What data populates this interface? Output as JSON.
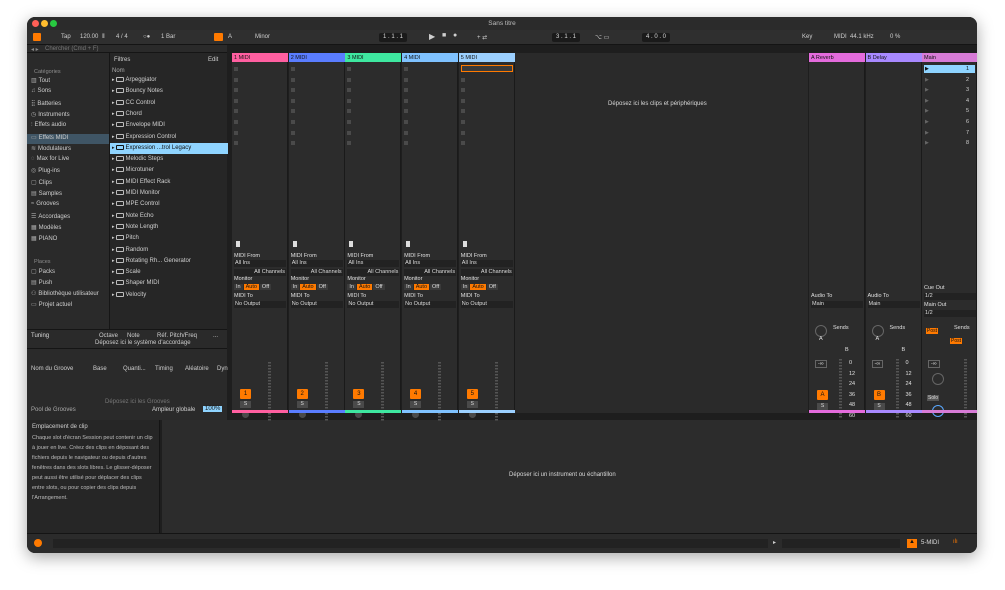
{
  "window": {
    "title": "Sans titre"
  },
  "toolbar": {
    "tap": "Tap",
    "tempo": "120.00",
    "signature": "4 / 4",
    "quantize": "1 Bar",
    "key_root": "A",
    "scale": "Minor",
    "position": "1 .  1 .  1",
    "loop_start": "3 .  1 .  1",
    "loop_length": "4 .  0 .  0",
    "key": "Key",
    "midi": "MIDI",
    "sample_rate": "44.1 kHz",
    "cpu": "0 %"
  },
  "browser": {
    "search_placeholder": "Chercher (Cmd + F)",
    "categories_label": "Catégories",
    "categories": [
      "Tout",
      "Sons",
      "Batteries",
      "Instruments",
      "Effets audio",
      "Effets MIDI",
      "Modulateurs",
      "Max for Live",
      "Plug-ins",
      "Clips",
      "Samples",
      "Grooves",
      "Accordages",
      "Modèles",
      "PIANO"
    ],
    "places_label": "Places",
    "places": [
      "Packs",
      "Push",
      "Bibliothèque utilisateur",
      "Projet actuel"
    ],
    "filters": "Filtres",
    "edit": "Edit",
    "name_col": "Nom",
    "items": [
      "Arpeggiator",
      "Bouncy Notes",
      "CC Control",
      "Chord",
      "Envelope MIDI",
      "Expression Control",
      "Expression ...trol Legacy",
      "Melodic Steps",
      "Microtuner",
      "MIDI Effect Rack",
      "MIDI Monitor",
      "MPE Control",
      "Note Echo",
      "Note Length",
      "Pitch",
      "Random",
      "Rotating Rh... Generator",
      "Scale",
      "Shaper MIDI",
      "Velocity"
    ]
  },
  "tuning": {
    "title": "Tuning",
    "cols": [
      "Octave",
      "Note",
      "Réf. Pitch/Freq",
      "..."
    ],
    "drop": "Déposez ici le système d'accordage"
  },
  "groove": {
    "cols": [
      "Nom du Groove",
      "Base",
      "Quanti...",
      "Timing",
      "Aléatoire",
      "Dyn"
    ],
    "drop": "Déposez ici les Grooves",
    "pool": "Pool de Grooves",
    "amount_label": "Ampleur globale",
    "amount": "100%"
  },
  "info": {
    "title": "Emplacement de clip",
    "text": "Chaque slot d'écran Session peut contenir un clip à jouer en live. Créez des clips en déposant des fichiers depuis le navigateur ou depuis d'autres fenêtres dans des slots libres. Le glisser-déposer peut aussi être utilisé pour déplacer des clips entre slots, ou pour copier des clips depuis l'Arrangement."
  },
  "session_drop": "Déposez ici les clips et périphériques",
  "detail_drop": "Déposer ici un instrument ou échantillon",
  "tracks": [
    {
      "name": "1 MIDI",
      "color": "#ff5fa0",
      "num": "1"
    },
    {
      "name": "2 MIDI",
      "color": "#5a7dff",
      "num": "2"
    },
    {
      "name": "3 MIDI",
      "color": "#3ee8a0",
      "num": "3"
    },
    {
      "name": "4 MIDI",
      "color": "#7fc2ff",
      "num": "4"
    },
    {
      "name": "5 MIDI",
      "color": "#9bd0ff",
      "num": "5"
    }
  ],
  "io": {
    "midi_from": "MIDI From",
    "all_ins": "All Ins",
    "all_channels": "All Channels",
    "monitor": "Monitor",
    "in": "In",
    "auto": "Auto",
    "off": "Off",
    "midi_to": "MIDI To",
    "no_output": "No Output",
    "solo": "S"
  },
  "returns": [
    {
      "name": "A Reverb",
      "color": "#e46bdc",
      "letter": "A"
    },
    {
      "name": "B Delay",
      "color": "#a889ff",
      "letter": "B"
    }
  ],
  "returns_io": {
    "audio_to": "Audio To",
    "main": "Main",
    "sends": "Sends",
    "send_a": "A",
    "send_b": "B",
    "inf": "-∞"
  },
  "main": {
    "name": "Main",
    "scenes": [
      "1",
      "2",
      "3",
      "4",
      "5",
      "6",
      "7",
      "8"
    ],
    "cue_out": "Cue Out",
    "cue_val": "1/2",
    "main_out": "Main Out",
    "main_val": "1/2",
    "sends": "Sends",
    "post": "Post",
    "solo": "Solo",
    "db": [
      "0",
      "12",
      "24",
      "36",
      "48",
      "60"
    ]
  },
  "status": {
    "track": "5-MIDI"
  },
  "colors": {
    "accent": "#ff7a00",
    "selection": "#8fd4ff"
  }
}
